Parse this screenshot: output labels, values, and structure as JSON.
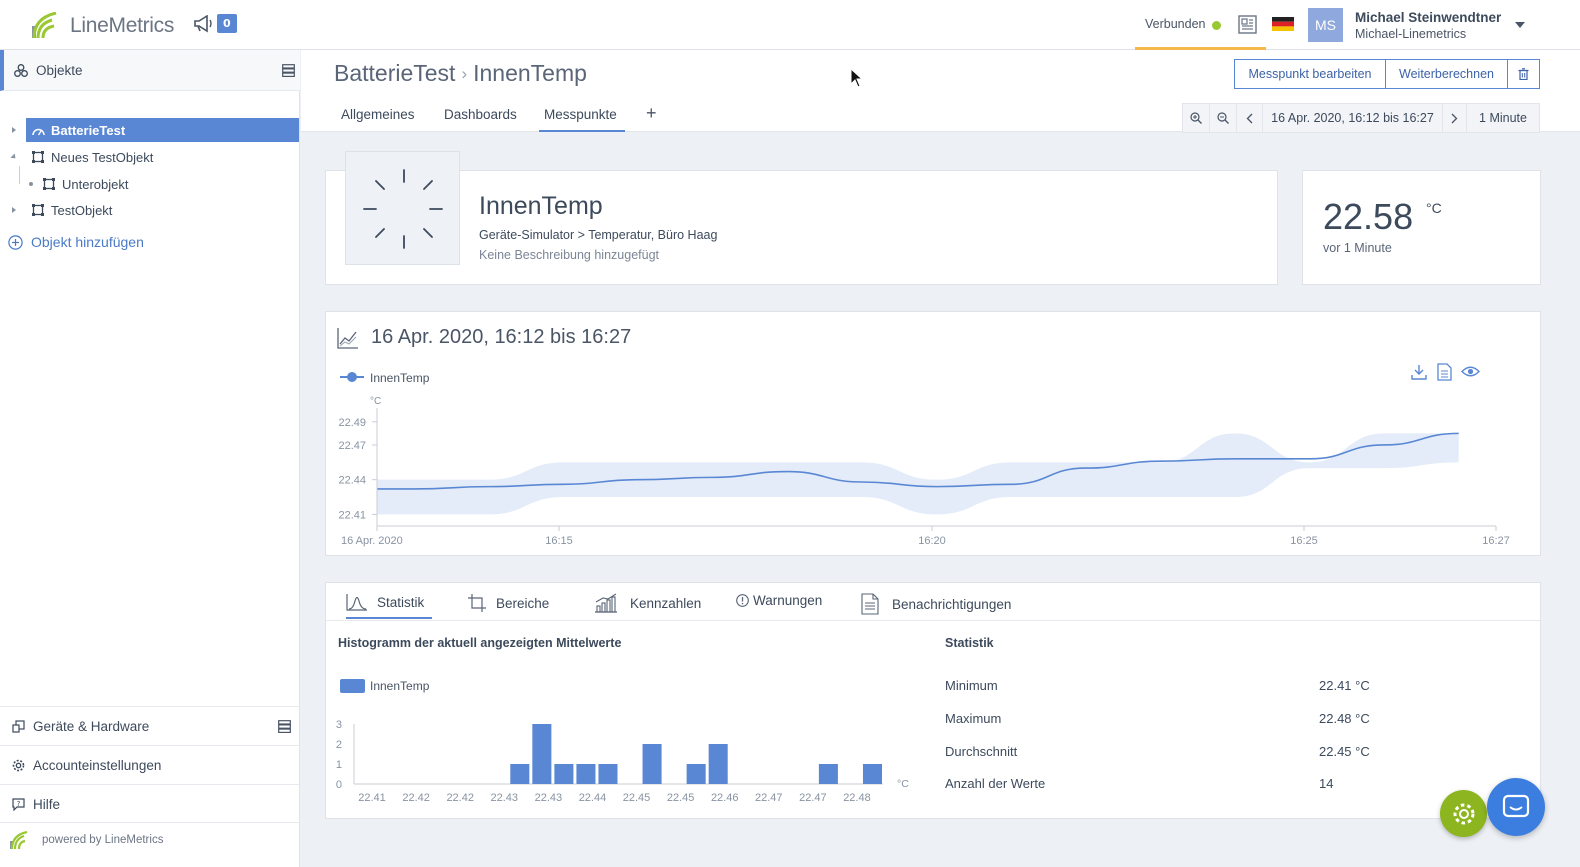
{
  "topbar": {
    "logo_text": "LineMetrics",
    "announce_count": "0",
    "connection_label": "Verbunden",
    "user_initials": "MS",
    "user_name": "Michael Steinwendtner",
    "user_org": "Michael-Linemetrics"
  },
  "sidebar": {
    "header_label": "Objekte",
    "tree": [
      {
        "label": "BatterieTest",
        "selected": true
      },
      {
        "label": "Neues TestObjekt"
      },
      {
        "label": "Unterobjekt"
      },
      {
        "label": "TestObjekt"
      }
    ],
    "add_object_label": "Objekt hinzufügen",
    "bottom": [
      {
        "label": "Geräte & Hardware"
      },
      {
        "label": "Accounteinstellungen"
      },
      {
        "label": "Hilfe"
      }
    ],
    "powered_by": "powered by LineMetrics"
  },
  "header": {
    "breadcrumb_parent": "BatterieTest",
    "breadcrumb_sep": "›",
    "breadcrumb_current": "InnenTemp",
    "tabs": [
      "Allgemeines",
      "Dashboards",
      "Messpunkte"
    ],
    "add_tab": "+",
    "btn_edit": "Messpunkt bearbeiten",
    "btn_recalc": "Weiterberechnen",
    "range_text": "16 Apr. 2020, 16:12 bis 16:27",
    "resolution": "1 Minute"
  },
  "measurepoint": {
    "name": "InnenTemp",
    "path": "Geräte-Simulator > Temperatur, Büro Haag",
    "description": "Keine Beschreibung hinzugefügt",
    "value": "22.58",
    "unit": "°C",
    "updated": "vor 1 Minute"
  },
  "chart": {
    "title": "16 Apr. 2020, 16:12 bis 16:27",
    "legend": "InnenTemp",
    "unit": "°C"
  },
  "stats_tabs": [
    "Statistik",
    "Bereiche",
    "Kennzahlen",
    "Warnungen",
    "Benachrichtigungen"
  ],
  "histogram": {
    "title": "Histogramm der aktuell angezeigten Mittelwerte",
    "legend": "InnenTemp",
    "unit": "°C"
  },
  "statistics": {
    "title": "Statistik",
    "rows": [
      {
        "label": "Minimum",
        "value": "22.41 °C"
      },
      {
        "label": "Maximum",
        "value": "22.48 °C"
      },
      {
        "label": "Durchschnitt",
        "value": "22.45 °C"
      },
      {
        "label": "Anzahl der Werte",
        "value": "14"
      }
    ]
  },
  "colors": {
    "accent": "#5a87d4",
    "connected": "#9ac833",
    "gear_fab": "#8cb51f",
    "chat_fab": "#3b7ee0"
  },
  "chart_data": [
    {
      "type": "line",
      "title": "16 Apr. 2020, 16:12 bis 16:27",
      "ylabel": "°C",
      "ylim": [
        22.4,
        22.495
      ],
      "y_ticks": [
        "22.41",
        "22.44",
        "22.47",
        "22.49"
      ],
      "x_ticks": [
        "16 Apr. 2020",
        "16:15",
        "16:20",
        "16:25",
        "16:27"
      ],
      "series": [
        {
          "name": "InnenTemp",
          "x": [
            "16:12",
            "16:13",
            "16:14",
            "16:15",
            "16:16",
            "16:17",
            "16:18",
            "16:19",
            "16:20",
            "16:21",
            "16:22",
            "16:23",
            "16:24",
            "16:25",
            "16:26"
          ],
          "values": [
            22.432,
            22.434,
            22.436,
            22.44,
            22.442,
            22.447,
            22.438,
            22.434,
            22.436,
            22.45,
            22.456,
            22.458,
            22.458,
            22.47,
            22.48
          ],
          "band_low": [
            22.41,
            22.41,
            22.425,
            22.425,
            22.425,
            22.425,
            22.425,
            22.41,
            22.425,
            22.425,
            22.425,
            22.425,
            22.45,
            22.45,
            22.455
          ],
          "band_high": [
            22.44,
            22.44,
            22.455,
            22.455,
            22.455,
            22.455,
            22.455,
            22.44,
            22.455,
            22.455,
            22.455,
            22.48,
            22.455,
            22.48,
            22.48
          ]
        }
      ]
    },
    {
      "type": "bar",
      "title": "Histogramm der aktuell angezeigten Mittelwerte",
      "xlabel": "°C",
      "ylim": [
        0,
        3
      ],
      "y_ticks": [
        "0",
        "1",
        "2",
        "3"
      ],
      "categories": [
        "22.41",
        "22.42",
        "22.42",
        "22.43",
        "22.43",
        "22.44",
        "22.45",
        "22.45",
        "22.46",
        "22.47",
        "22.47",
        "22.48"
      ],
      "bins": 24,
      "values": [
        0,
        0,
        0,
        0,
        0,
        0,
        0,
        1,
        3,
        1,
        1,
        1,
        0,
        2,
        0,
        1,
        2,
        0,
        0,
        0,
        0,
        1,
        0,
        1
      ]
    }
  ]
}
